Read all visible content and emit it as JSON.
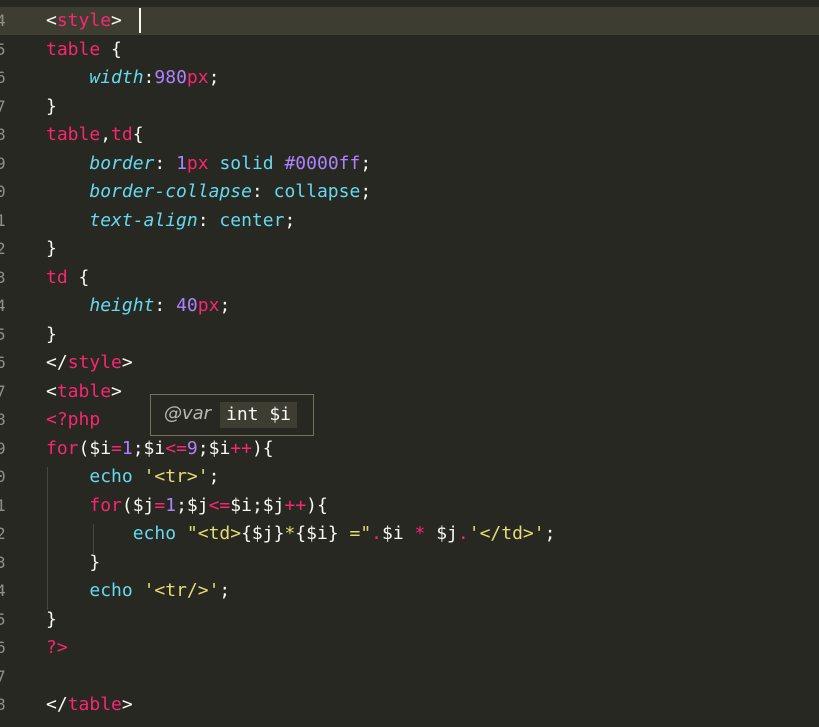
{
  "editor": {
    "theme_colors": {
      "background": "#272822",
      "current_line": "#3e3d32",
      "tag": "#f92672",
      "property": "#66d9ef",
      "number": "#ae81ff",
      "string": "#e6db74",
      "text": "#f8f8f2",
      "gutter": "#90908a"
    },
    "line_numbers": [
      "4",
      "5",
      "6",
      "7",
      "8",
      "9",
      "0",
      "1",
      "2",
      "3",
      "4",
      "5",
      "6",
      "7",
      "8",
      "9",
      "0",
      "1",
      "2",
      "3",
      "4",
      "5",
      "6",
      "7",
      "8"
    ],
    "lines": [
      [
        {
          "t": "<",
          "c": "tok-punct"
        },
        {
          "t": "style",
          "c": "tok-tag"
        },
        {
          "t": ">",
          "c": "tok-punct"
        },
        {
          "t": " ",
          "c": "tok-plain"
        }
      ],
      [
        {
          "t": "table",
          "c": "tok-tag"
        },
        {
          "t": " {",
          "c": "tok-punct"
        }
      ],
      [
        {
          "t": "    ",
          "c": "tok-plain"
        },
        {
          "t": "width",
          "c": "tok-prop"
        },
        {
          "t": ":",
          "c": "tok-punct"
        },
        {
          "t": "980",
          "c": "tok-num"
        },
        {
          "t": "px",
          "c": "tok-unit"
        },
        {
          "t": ";",
          "c": "tok-punct"
        }
      ],
      [
        {
          "t": "}",
          "c": "tok-punct"
        }
      ],
      [
        {
          "t": "table",
          "c": "tok-tag"
        },
        {
          "t": ",",
          "c": "tok-punct"
        },
        {
          "t": "td",
          "c": "tok-tag"
        },
        {
          "t": "{",
          "c": "tok-punct"
        }
      ],
      [
        {
          "t": "    ",
          "c": "tok-plain"
        },
        {
          "t": "border",
          "c": "tok-prop"
        },
        {
          "t": ": ",
          "c": "tok-punct"
        },
        {
          "t": "1",
          "c": "tok-num"
        },
        {
          "t": "px",
          "c": "tok-unit"
        },
        {
          "t": " solid ",
          "c": "tok-func"
        },
        {
          "t": "#0000ff",
          "c": "tok-num"
        },
        {
          "t": ";",
          "c": "tok-punct"
        }
      ],
      [
        {
          "t": "    ",
          "c": "tok-plain"
        },
        {
          "t": "border-collapse",
          "c": "tok-prop"
        },
        {
          "t": ": ",
          "c": "tok-punct"
        },
        {
          "t": "collapse",
          "c": "tok-func"
        },
        {
          "t": ";",
          "c": "tok-punct"
        }
      ],
      [
        {
          "t": "    ",
          "c": "tok-plain"
        },
        {
          "t": "text-align",
          "c": "tok-prop"
        },
        {
          "t": ": ",
          "c": "tok-punct"
        },
        {
          "t": "center",
          "c": "tok-func"
        },
        {
          "t": ";",
          "c": "tok-punct"
        }
      ],
      [
        {
          "t": "}",
          "c": "tok-punct"
        }
      ],
      [
        {
          "t": "td",
          "c": "tok-tag"
        },
        {
          "t": " {",
          "c": "tok-punct"
        }
      ],
      [
        {
          "t": "    ",
          "c": "tok-plain"
        },
        {
          "t": "height",
          "c": "tok-prop"
        },
        {
          "t": ": ",
          "c": "tok-punct"
        },
        {
          "t": "40",
          "c": "tok-num"
        },
        {
          "t": "px",
          "c": "tok-unit"
        },
        {
          "t": ";",
          "c": "tok-punct"
        }
      ],
      [
        {
          "t": "}",
          "c": "tok-punct"
        }
      ],
      [
        {
          "t": "</",
          "c": "tok-punct"
        },
        {
          "t": "style",
          "c": "tok-tag"
        },
        {
          "t": ">",
          "c": "tok-punct"
        }
      ],
      [
        {
          "t": "<",
          "c": "tok-punct"
        },
        {
          "t": "table",
          "c": "tok-tag"
        },
        {
          "t": ">",
          "c": "tok-punct"
        }
      ],
      [
        {
          "t": "<?php",
          "c": "tok-kw"
        }
      ],
      [
        {
          "t": "for",
          "c": "tok-kw"
        },
        {
          "t": "($i",
          "c": "tok-var"
        },
        {
          "t": "=",
          "c": "tok-op"
        },
        {
          "t": "1",
          "c": "tok-num"
        },
        {
          "t": ";$i",
          "c": "tok-var"
        },
        {
          "t": "<=",
          "c": "tok-op"
        },
        {
          "t": "9",
          "c": "tok-num"
        },
        {
          "t": ";$i",
          "c": "tok-var"
        },
        {
          "t": "++",
          "c": "tok-op"
        },
        {
          "t": "){",
          "c": "tok-punct"
        }
      ],
      [
        {
          "t": "    ",
          "c": "tok-plain"
        },
        {
          "t": "echo",
          "c": "tok-func"
        },
        {
          "t": " ",
          "c": "tok-plain"
        },
        {
          "t": "'<tr>'",
          "c": "tok-str"
        },
        {
          "t": ";",
          "c": "tok-punct"
        }
      ],
      [
        {
          "t": "    ",
          "c": "tok-plain"
        },
        {
          "t": "for",
          "c": "tok-kw"
        },
        {
          "t": "($j",
          "c": "tok-var"
        },
        {
          "t": "=",
          "c": "tok-op"
        },
        {
          "t": "1",
          "c": "tok-num"
        },
        {
          "t": ";$j",
          "c": "tok-var"
        },
        {
          "t": "<=",
          "c": "tok-op"
        },
        {
          "t": "$i;$j",
          "c": "tok-var"
        },
        {
          "t": "++",
          "c": "tok-op"
        },
        {
          "t": "){",
          "c": "tok-punct"
        }
      ],
      [
        {
          "t": "        ",
          "c": "tok-plain"
        },
        {
          "t": "echo",
          "c": "tok-func"
        },
        {
          "t": " ",
          "c": "tok-plain"
        },
        {
          "t": "\"<td>",
          "c": "tok-str"
        },
        {
          "t": "{$j}",
          "c": "tok-var"
        },
        {
          "t": "*",
          "c": "tok-str"
        },
        {
          "t": "{$i}",
          "c": "tok-var"
        },
        {
          "t": " =\"",
          "c": "tok-str"
        },
        {
          "t": ".",
          "c": "tok-op"
        },
        {
          "t": "$i ",
          "c": "tok-var"
        },
        {
          "t": "*",
          "c": "tok-op"
        },
        {
          "t": " $j",
          "c": "tok-var"
        },
        {
          "t": ".",
          "c": "tok-op"
        },
        {
          "t": "'</td>'",
          "c": "tok-str"
        },
        {
          "t": ";",
          "c": "tok-punct"
        }
      ],
      [
        {
          "t": "    ",
          "c": "tok-plain"
        },
        {
          "t": "}",
          "c": "tok-punct"
        }
      ],
      [
        {
          "t": "    ",
          "c": "tok-plain"
        },
        {
          "t": "echo",
          "c": "tok-func"
        },
        {
          "t": " ",
          "c": "tok-plain"
        },
        {
          "t": "'<tr/>'",
          "c": "tok-str"
        },
        {
          "t": ";",
          "c": "tok-punct"
        }
      ],
      [
        {
          "t": "}",
          "c": "tok-punct"
        }
      ],
      [
        {
          "t": "?>",
          "c": "tok-kw"
        }
      ],
      [],
      [
        {
          "t": "</",
          "c": "tok-punct"
        },
        {
          "t": "table",
          "c": "tok-tag"
        },
        {
          "t": ">",
          "c": "tok-punct"
        }
      ]
    ]
  },
  "tooltip": {
    "tag": "@var",
    "type": "int $i"
  }
}
